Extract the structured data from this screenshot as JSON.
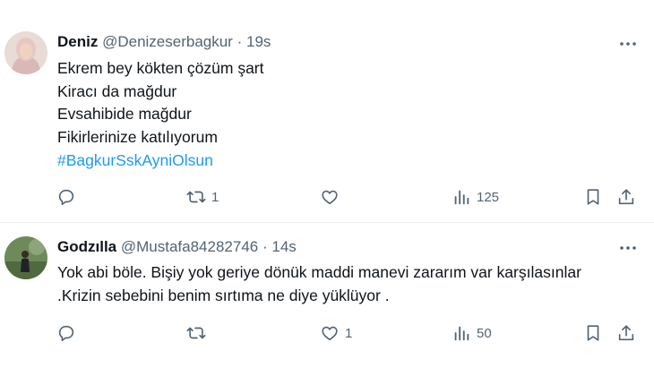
{
  "tweets": [
    {
      "name": "Deniz",
      "handle": "@Denizeserbagkur",
      "separator": "·",
      "time": "19s",
      "lines": [
        "Ekrem bey kökten çözüm şart",
        "Kiracı da mağdur",
        "Evsahibide mağdur",
        "Fikirlerinize katılıyorum"
      ],
      "hashtag": "#BagkurSskAyniOlsun",
      "retweets": "1",
      "likes": "",
      "views": "125",
      "icons": [
        "more-icon",
        "reply-icon",
        "retweet-icon",
        "like-icon",
        "views-icon",
        "bookmark-icon",
        "share-icon"
      ]
    },
    {
      "name": "Godzılla",
      "handle": "@Mustafa84282746",
      "separator": "·",
      "time": "14s",
      "lines": [
        "Yok abi böle. Bişiy yok geriye dönük maddi manevi zararım var karşılasınlar",
        ".Krizin sebebini benim sırtıma ne diye yüklüyor ."
      ],
      "retweets": "",
      "likes": "1",
      "views": "50",
      "icons": [
        "more-icon",
        "reply-icon",
        "retweet-icon",
        "like-icon",
        "views-icon",
        "bookmark-icon",
        "share-icon"
      ]
    }
  ],
  "colors": {
    "text": "#0f1419",
    "secondary": "#536471",
    "link": "#1d9bf0",
    "divider": "#eff3f4"
  }
}
